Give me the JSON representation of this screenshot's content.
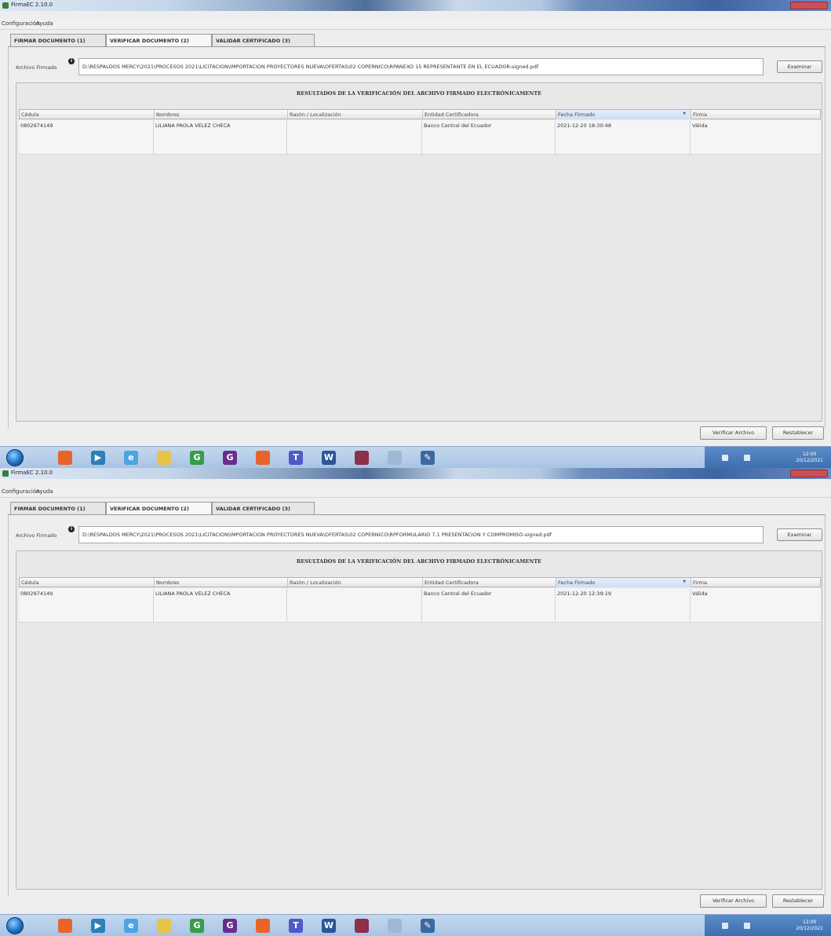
{
  "screens": [
    {
      "window_title": "FirmaEC 2.10.0",
      "menu": [
        "Configuración",
        "Ayuda"
      ],
      "tabs": [
        {
          "label": "FIRMAR DOCUMENTO (1)",
          "active": false
        },
        {
          "label": "VERIFICAR DOCUMENTO (2)",
          "active": true
        },
        {
          "label": "VALIDAR CERTIFICADO (3)",
          "active": false
        }
      ],
      "file_label": "Archivo Firmado",
      "file_path": "D:\\RESPALDOS MERCY\\2021\\PROCESOS 2021\\LICITACION\\IMPORTACION PROYECTORES NUEVA\\OFERTAS\\02 COPERNICO\\RPANEXO 15 REPRESENTANTE EN EL ECUADOR-signed.pdf",
      "examinar_label": "Examinar",
      "results_title": "RESULTADOS DE LA VERIFICACIÓN DEL ARCHIVO FIRMADO ELECTRÓNICAMENTE",
      "columns": [
        "Cédula",
        "Nombres",
        "Razón / Localización",
        "Entidad Certificadora",
        "Fecha Firmado",
        "Firma"
      ],
      "rows": [
        {
          "cedula": "0802974149",
          "nombres": "LILIANA PAOLA VELEZ CHECA",
          "razon": "",
          "entidad": "Banco Central del Ecuador",
          "fecha": "2021-12-20 18:30:48",
          "firma": "Válida"
        }
      ],
      "verificar_label": "Verificar Archivo",
      "restablecer_label": "Restablecer",
      "clock": {
        "time": "12:00",
        "date": "20/12/2021"
      }
    },
    {
      "window_title": "FirmaEC 2.10.0",
      "menu": [
        "Configuración",
        "Ayuda"
      ],
      "tabs": [
        {
          "label": "FIRMAR DOCUMENTO (1)",
          "active": false
        },
        {
          "label": "VERIFICAR DOCUMENTO (2)",
          "active": true
        },
        {
          "label": "VALIDAR CERTIFICADO (3)",
          "active": false
        }
      ],
      "file_label": "Archivo Firmado",
      "file_path": "D:\\RESPALDOS MERCY\\2021\\PROCESOS 2021\\LICITACION\\IMPORTACION PROYECTORES NUEVA\\OFERTAS\\02 COPERNICO\\RPFORMULARIO 7.1 PRESENTACION Y COMPROMISO-signed.pdf",
      "examinar_label": "Examinar",
      "results_title": "RESULTADOS DE LA VERIFICACIÓN DEL ARCHIVO FIRMADO ELECTRÓNICAMENTE",
      "columns": [
        "Cédula",
        "Nombres",
        "Razón / Localización",
        "Entidad Certificadora",
        "Fecha Firmado",
        "Firma"
      ],
      "rows": [
        {
          "cedula": "0802974149",
          "nombres": "LILIANA PAOLA VELEZ CHECA",
          "razon": "",
          "entidad": "Banco Central del Ecuador",
          "fecha": "2021-12-20 12:39:19",
          "firma": "Válida"
        }
      ],
      "verificar_label": "Verificar Archivo",
      "restablecer_label": "Restablecer",
      "clock": {
        "time": "12:00",
        "date": "20/12/2021"
      }
    }
  ],
  "taskbar_icons": [
    {
      "name": "firefox-icon",
      "color": "#e8642a",
      "glyph": ""
    },
    {
      "name": "media-player-icon",
      "color": "#2c7fb8",
      "glyph": "▶"
    },
    {
      "name": "ie-icon",
      "color": "#4fa3e0",
      "glyph": "e"
    },
    {
      "name": "folder-icon",
      "color": "#e8c34a",
      "glyph": ""
    },
    {
      "name": "chrome-icon",
      "color": "#3a9b4a",
      "glyph": "G"
    },
    {
      "name": "app-g-icon",
      "color": "#6a2c8c",
      "glyph": "G"
    },
    {
      "name": "firefox-icon-2",
      "color": "#e8642a",
      "glyph": ""
    },
    {
      "name": "teams-icon",
      "color": "#5059c9",
      "glyph": "T"
    },
    {
      "name": "word-icon",
      "color": "#2b5797",
      "glyph": "W"
    },
    {
      "name": "winrar-icon",
      "color": "#8b2f4a",
      "glyph": ""
    },
    {
      "name": "notepad-icon",
      "color": "#9fb8d6",
      "glyph": ""
    },
    {
      "name": "firmaec-icon",
      "color": "#3a6aa0",
      "glyph": "✎"
    }
  ]
}
